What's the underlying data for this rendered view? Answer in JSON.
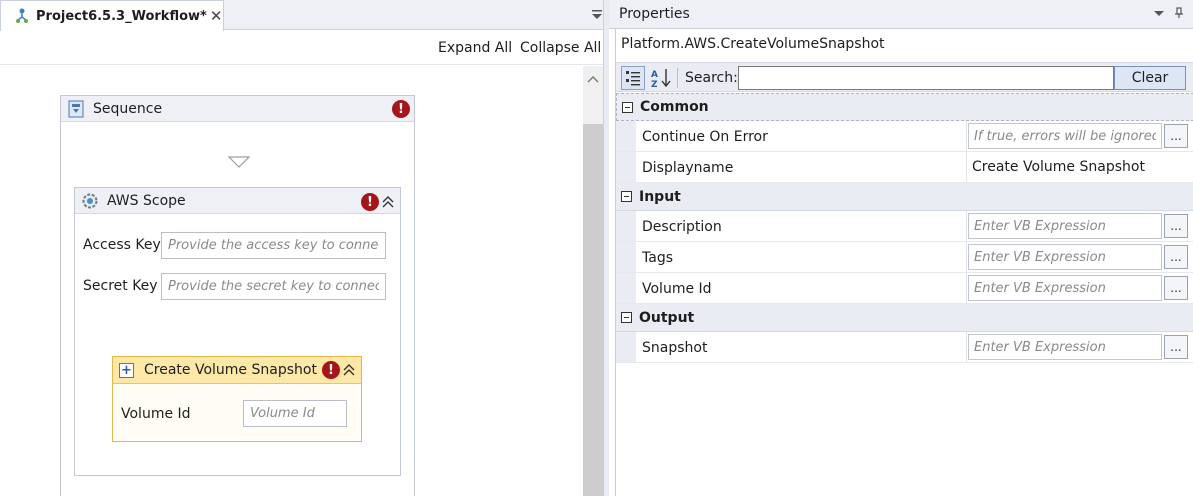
{
  "designer": {
    "tab_title": "Project6.5.3_Workflow*",
    "tab_close": "✕",
    "expand_all": "Expand All",
    "collapse_all": "Collapse All",
    "sequence": {
      "title": "Sequence",
      "error_badge": "!"
    },
    "aws_scope": {
      "title": "AWS Scope",
      "error_badge": "!",
      "access_key_label": "Access Key",
      "access_key_placeholder": "Provide the access key to connect",
      "secret_key_label": "Secret Key",
      "secret_key_placeholder": "Provide the secret key to connect"
    },
    "create_volume_snapshot": {
      "title": "Create Volume Snapshot",
      "error_badge": "!",
      "plus": "+",
      "volume_id_label": "Volume Id",
      "volume_id_placeholder": "Volume Id"
    }
  },
  "properties": {
    "title": "Properties",
    "object_type": "Platform.AWS.CreateVolumeSnapshot",
    "search_label": "Search:",
    "search_value": "",
    "clear_label": "Clear",
    "ellipsis": "...",
    "categories": {
      "common": {
        "name": "Common",
        "continue_on_error": {
          "name": "Continue On Error",
          "placeholder": "If true, errors will be ignored"
        },
        "displayname": {
          "name": "Displayname",
          "value": "Create Volume Snapshot"
        }
      },
      "input": {
        "name": "Input",
        "description": {
          "name": "Description",
          "placeholder": "Enter VB Expression"
        },
        "tags": {
          "name": "Tags",
          "placeholder": "Enter VB Expression"
        },
        "volume_id": {
          "name": "Volume Id",
          "placeholder": "Enter VB Expression"
        }
      },
      "output": {
        "name": "Output",
        "snapshot": {
          "name": "Snapshot",
          "placeholder": "Enter VB Expression"
        }
      }
    }
  },
  "colors": {
    "error_red": "#a4161a",
    "activity_highlight": "#fde8a8",
    "pane_background": "#eef0f6"
  },
  "icons": {
    "workflow": "workflow-icon",
    "sequence": "sequence-icon",
    "aws_scope": "gear-icon",
    "categorized": "categorized-icon",
    "alphabetical": "sort-alphabetical-icon"
  }
}
